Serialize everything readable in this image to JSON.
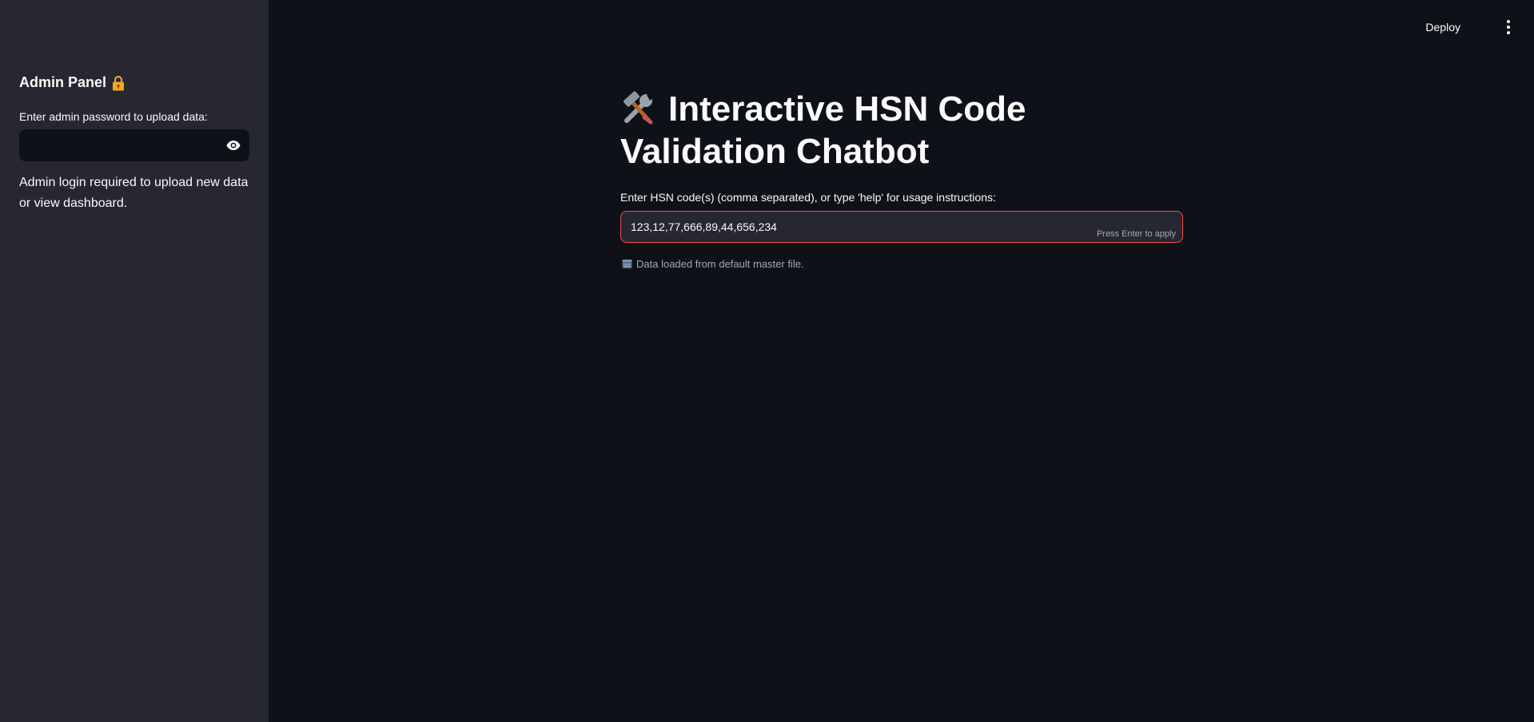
{
  "sidebar": {
    "title": "Admin Panel",
    "title_icon": "lock-icon",
    "password_label": "Enter admin password to upload data:",
    "password_value": "",
    "password_toggle_icon": "eye-icon",
    "note": "Admin login required to upload new data or view dashboard."
  },
  "topbar": {
    "deploy_label": "Deploy",
    "menu_icon": "vertical-dots-icon"
  },
  "main": {
    "title": "Interactive HSN Code Validation Chatbot",
    "title_icon": "hammer-and-wrench-icon",
    "input_label": "Enter HSN code(s) (comma separated), or type 'help' for usage instructions:",
    "input_value": "123,12,77,666,89,44,656,234",
    "input_hint": "Press Enter to apply",
    "status_icon": "database-icon",
    "status_text": "Data loaded from default master file."
  },
  "colors": {
    "background": "#0e1117",
    "sidebar": "#262730",
    "input_border_active": "#ff4b4b",
    "muted_text": "#a3a8b8"
  }
}
